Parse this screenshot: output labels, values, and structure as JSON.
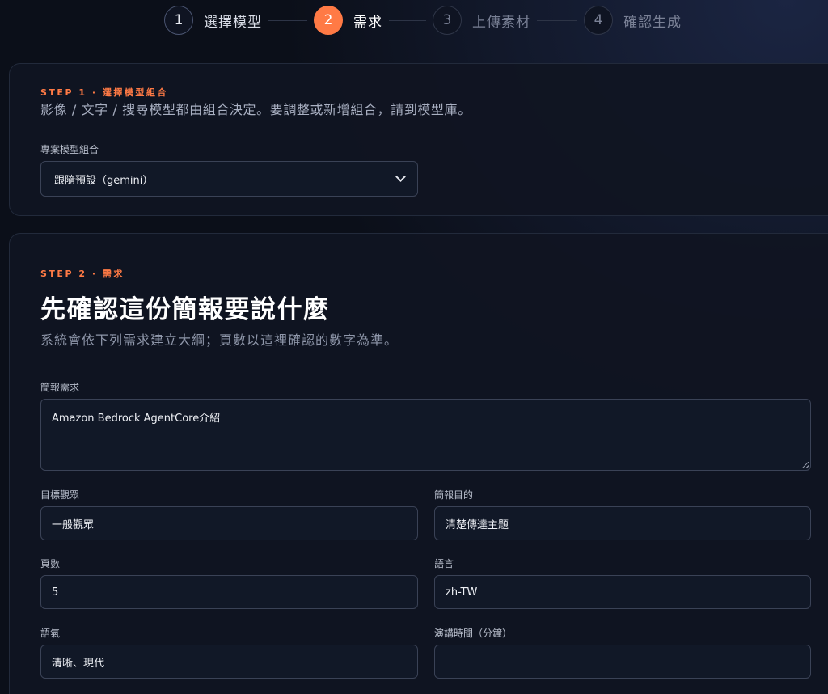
{
  "stepper": {
    "steps": [
      {
        "number": "1",
        "label": "選擇模型",
        "state": "done"
      },
      {
        "number": "2",
        "label": "需求",
        "state": "active"
      },
      {
        "number": "3",
        "label": "上傳素材",
        "state": "pending"
      },
      {
        "number": "4",
        "label": "確認生成",
        "state": "pending"
      }
    ]
  },
  "step1": {
    "eyebrow": "STEP 1 · 選擇模型組合",
    "description": "影像 / 文字 / 搜尋模型都由組合決定。要調整或新增組合，請到模型庫。",
    "field_label": "專案模型組合",
    "selected_option": "跟隨預設（gemini）"
  },
  "step2": {
    "eyebrow": "STEP 2 · 需求",
    "title": "先確認這份簡報要說什麼",
    "subtitle": "系統會依下列需求建立大綱；頁數以這裡確認的數字為準。",
    "fields": {
      "requirement": {
        "label": "簡報需求",
        "value": "Amazon Bedrock AgentCore介紹"
      },
      "audience": {
        "label": "目標觀眾",
        "value": "一般觀眾"
      },
      "purpose": {
        "label": "簡報目的",
        "value": "清楚傳達主題"
      },
      "pages": {
        "label": "頁數",
        "value": "5"
      },
      "language": {
        "label": "語言",
        "value": "zh-TW"
      },
      "tone": {
        "label": "語氣",
        "value": "清晰、現代"
      },
      "duration": {
        "label": "演講時間（分鐘）",
        "value": ""
      }
    }
  },
  "colors": {
    "accent": "#ff7a45",
    "background": "#0b0f19",
    "card": "#101522",
    "border": "#3a4256"
  }
}
